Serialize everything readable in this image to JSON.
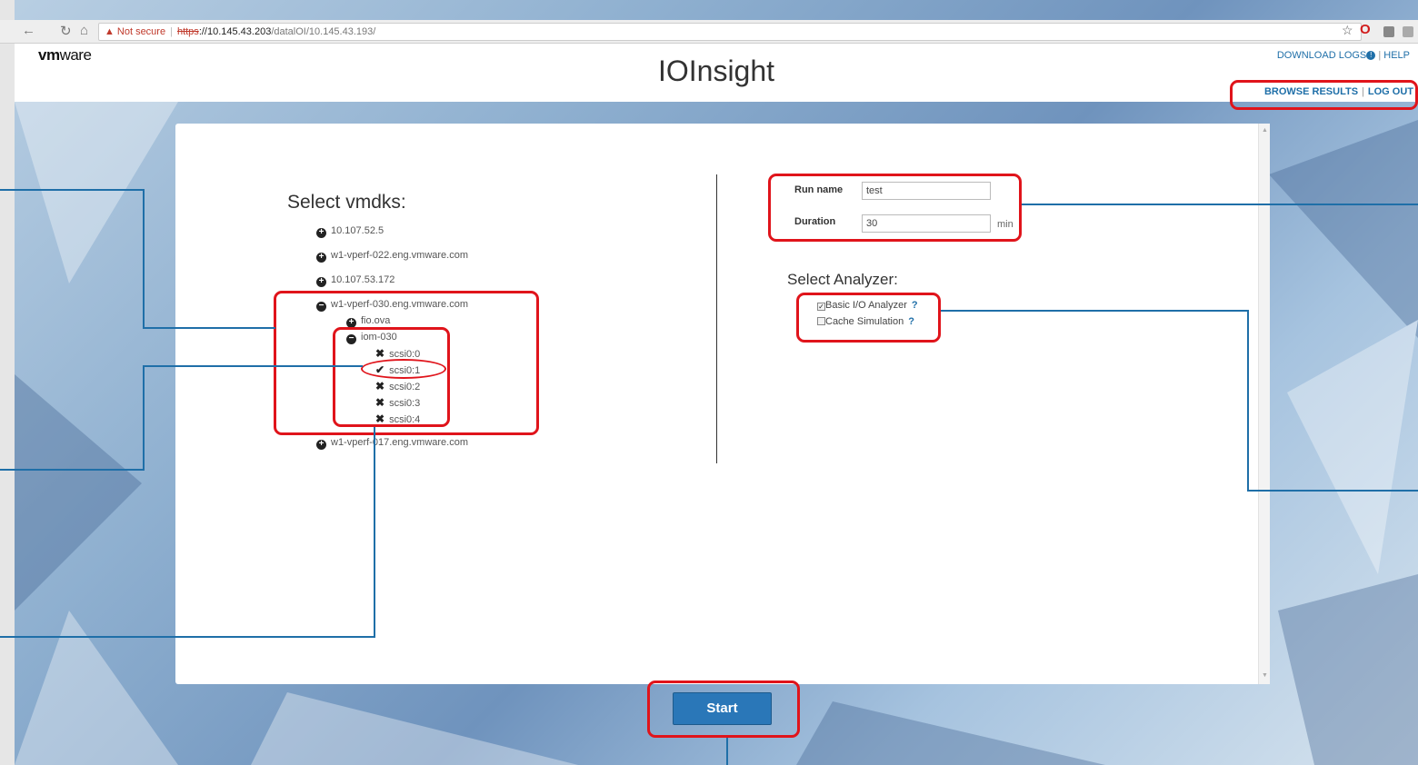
{
  "browser": {
    "security_label": "Not secure",
    "url_scheme": "https",
    "url_host": "://10.145.43.203",
    "url_path": "/datalOI/10.145.43.193/"
  },
  "header": {
    "logo_bold": "vm",
    "logo_rest": "ware",
    "title": "IOInsight",
    "download_logs": "DOWNLOAD LOGS",
    "help": "HELP",
    "browse_results": "BROWSE RESULTS",
    "log_out": "LOG OUT"
  },
  "vmdks": {
    "title": "Select vmdks:",
    "hosts": [
      {
        "label": "10.107.52.5",
        "state": "collapsed"
      },
      {
        "label": "w1-vperf-022.eng.vmware.com",
        "state": "collapsed"
      },
      {
        "label": "10.107.53.172",
        "state": "collapsed"
      },
      {
        "label": "w1-vperf-030.eng.vmware.com",
        "state": "expanded"
      },
      {
        "label": "w1-vperf-017.eng.vmware.com",
        "state": "collapsed"
      }
    ],
    "vms": [
      {
        "label": "fio.ova",
        "state": "collapsed"
      },
      {
        "label": "iom-030",
        "state": "expanded"
      }
    ],
    "disks": [
      {
        "label": "scsi0:0",
        "selected": false
      },
      {
        "label": "scsi0:1",
        "selected": true
      },
      {
        "label": "scsi0:2",
        "selected": false
      },
      {
        "label": "scsi0:3",
        "selected": false
      },
      {
        "label": "scsi0:4",
        "selected": false
      }
    ]
  },
  "run": {
    "name_label": "Run name",
    "name_value": "test",
    "duration_label": "Duration",
    "duration_value": "30",
    "duration_unit": "min"
  },
  "analyzer": {
    "title": "Select Analyzer:",
    "options": [
      {
        "label": "Basic I/O Analyzer",
        "checked": true,
        "help": "?"
      },
      {
        "label": "Cache Simulation",
        "checked": false,
        "help": "?"
      }
    ]
  },
  "start_label": "Start",
  "colors": {
    "accent": "#2a77b8",
    "callout": "#e0141b",
    "link": "#1f6fa8"
  }
}
